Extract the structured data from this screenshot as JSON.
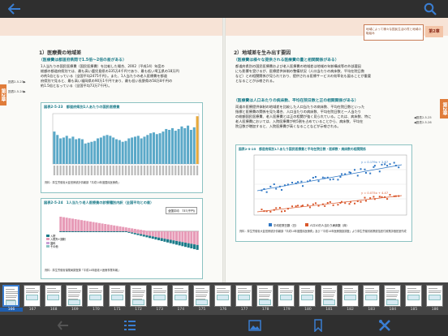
{
  "spread": {
    "left_page": {
      "chapter_tab": "第2章",
      "section_title": "1）医療費の地域差",
      "subheading": "（医療費は都道府県間で1.5倍〜2倍の差がある）",
      "body_lines": [
        "1人当たりの国民医療費（国民医療費）を比較した場合、2002（平成14）年度の",
        "総額の都道府県別では、最も高い鹿児島県の335万4千円であり、最も低い埼玉県の18万円",
        "の約1倍となっている（全国平均2475千円）。また、1人当たりの老人医療費を都道",
        "府県別で見ると、最も高い福岡県の90万1千円であり、最も低い長野県の58万8千円の",
        "約1.5倍となっている（全国平均73万7千円）。"
      ],
      "side_refs": [
        "図表2-5-23▶",
        "図表2-5-24▶"
      ],
      "fig1_title": "図表2-5-23　都道府県別1人あたりの国民医療費",
      "fig1_note": "資料：厚生労働省大臣官房統計情報部「平成14年度国民医療費」",
      "fig2_title": "図表2-5-24　1人当たり老人医療費の診療種別内訳（全国平均との差）",
      "fig2_legend": [
        "入院",
        "入院外+調剤",
        "歯科",
        "その他"
      ],
      "fig2_box_label": "全国平均　737(千円)",
      "fig2_note": "資料：厚生労働省保険局調査課「平成14年度老人医療事業年報」"
    },
    "right_page": {
      "header_box": "地域によって様々な国民生活の質と地域の取組み",
      "chapter_tag": "第2章",
      "section_title": "2）地域差を生み出す要因",
      "sub1": "（医療費は様々な提供される医療費の量と相関関係がある）",
      "body1": [
        "都道府県別の国民医療費および老人医療費の地域差は地域の年齢構成等の外部要因",
        "にも影響を受けるが、医療提供体制の整備状況（人口当たりの病床数、平均在院日数",
        "など）との相関関係が見られており、提供される医療サービスの効率化も図ることが重要",
        "となることが示唆される。"
      ],
      "sub2": "（医療費は人口あたりの病床数、平均在院日数と正の相関関係がある）",
      "body2": [
        "両道の医療提供体制の地域差を比較した人口当たりの病床数、平均在院日数といった",
        "指標と医療費の関係を見た場合、人口当たりの病床数、平均在院日数と一人当たり",
        "の総額国民医療費、老人医療費とは正の相関が強く見られている。これは、病床数、特に",
        "老人医療費においては、入院医療費が約5割を占めていることから、病床数、平均在",
        "院日数が増加すると、入院医療費が高くなることなどが示唆される。"
      ],
      "side_refs": [
        "◀図表2-5-25",
        "◀図表2-5-26"
      ],
      "fig3_title": "図表2-5-25　都道府県別1人あたり国民医療費と平均在院日数・医師数・病床数の相関関係",
      "fig3_legend": [
        "平均在院日数（日）",
        "人口10万人当たり病床数（床）"
      ],
      "fig3_eq1": "y = 0.179x + 2.67",
      "fig3_eq2": "y = 0.075x + 4.47",
      "fig3_note": "資料：厚生労働省大臣官房統計情報部「平成14年度国民医療費」及び「平成14年医療施設調査」より厚生労働省政策統括官付政策評価官室作成"
    }
  },
  "thumbnails": [
    "166",
    "167",
    "168",
    "169",
    "170",
    "171",
    "172",
    "173",
    "174",
    "175",
    "176",
    "177",
    "178",
    "179",
    "180",
    "181",
    "182",
    "183",
    "184",
    "185",
    "186"
  ],
  "active_thumbnail": "166",
  "toolbar": [
    "back-arrow-icon",
    "list-icon",
    "image-icon",
    "bookmark-icon",
    "tools-icon"
  ],
  "colors": {
    "accent": "#1b7b89",
    "chapter": "#e07c3a",
    "bar": "#5aa8c8",
    "bar_highlight": "#e8a93a",
    "selection": "#3a7ed2"
  }
}
